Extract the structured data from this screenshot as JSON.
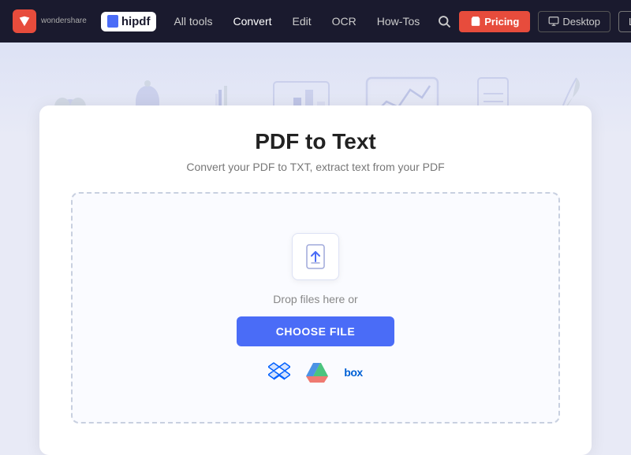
{
  "brand": {
    "wondershare_label": "wondershare",
    "hipdf_label": "hipdf"
  },
  "navbar": {
    "all_tools": "All tools",
    "convert": "Convert",
    "edit": "Edit",
    "ocr": "OCR",
    "how_tos": "How-Tos",
    "pricing": "Pricing",
    "desktop": "Desktop",
    "login": "Log In"
  },
  "page": {
    "title": "PDF to Text",
    "subtitle": "Convert your PDF to TXT, extract text from your PDF",
    "drop_text": "Drop files here or",
    "choose_file": "CHOOSE FILE"
  },
  "cloud_services": [
    "dropbox",
    "google-drive",
    "box"
  ]
}
